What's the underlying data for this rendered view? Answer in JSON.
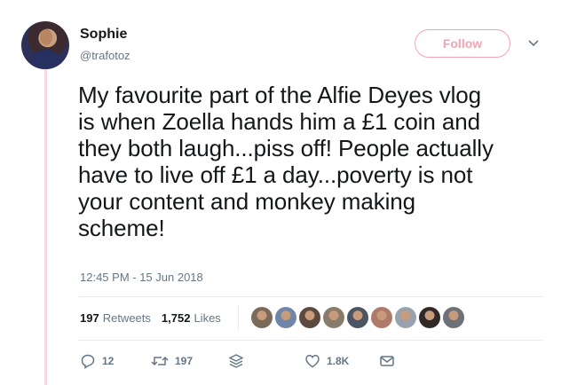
{
  "author": {
    "display_name": "Sophie",
    "handle": "@trafotoz"
  },
  "header": {
    "follow_label": "Follow"
  },
  "tweet": {
    "text": "My favourite part of the Alfie Deyes vlog\nis when Zoella hands him a £1 coin and\nthey both laugh...piss off! People actually\nhave to live off £1 a day...poverty is not\nyour content and monkey making\nscheme!",
    "timestamp": "12:45 PM - 15 Jun 2018"
  },
  "stats": {
    "retweets_count": "197",
    "retweets_label": "Retweets",
    "likes_count": "1,752",
    "likes_label": "Likes"
  },
  "liker_avatars": [
    "#7a6a5a",
    "#6f86a8",
    "#5d4a3e",
    "#8a7c6b",
    "#4b5563",
    "#b07a6a",
    "#9aa3ad",
    "#2f2a28",
    "#6e7177"
  ],
  "actions": {
    "replies": "12",
    "retweets": "197",
    "likes": "1.8K"
  },
  "colors": {
    "accent": "#f4a3b5",
    "muted": "#657786",
    "thread_line": "#f9d7de"
  }
}
